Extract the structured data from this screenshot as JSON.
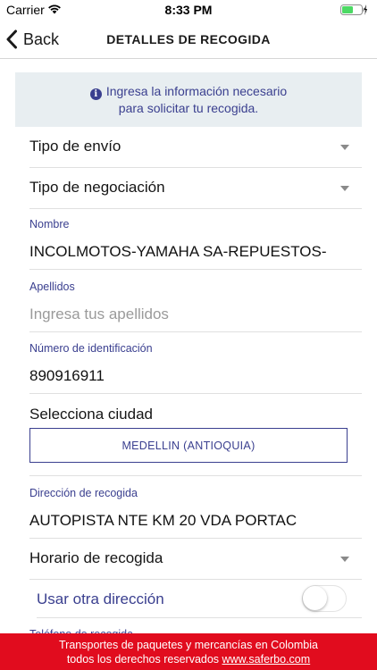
{
  "status_bar": {
    "carrier": "Carrier",
    "time": "8:33 PM"
  },
  "nav": {
    "back_label": "Back",
    "title": "DETALLES DE RECOGIDA"
  },
  "info": {
    "line1": "Ingresa la información necesario",
    "line2": "para solicitar tu recogida."
  },
  "form": {
    "shipment_type": "Tipo de envío",
    "negotiation_type": "Tipo de negociación",
    "name_label": "Nombre",
    "name_value": "INCOLMOTOS-YAMAHA SA-REPUESTOS-",
    "surname_label": "Apellidos",
    "surname_placeholder": "Ingresa tus apellidos",
    "id_label": "Número de identificación",
    "id_value": "890916911",
    "city_heading": "Selecciona ciudad",
    "city_value": "MEDELLIN (ANTIOQUIA)",
    "address_label": "Dirección de recogida",
    "address_value": "AUTOPISTA NTE KM 20 VDA PORTAC",
    "schedule": "Horario de recogida",
    "other_address_label": "Usar otra dirección",
    "other_address_on": false,
    "next_label": "Teléfono de recogida"
  },
  "footer": {
    "line1": "Transportes de paquetes y mercancías en Colombia",
    "line2_prefix": "todos los derechos reservados ",
    "link": "www.saferbo.com"
  },
  "colors": {
    "accent": "#3a3f8f",
    "footer_bg": "#e10c1e",
    "banner_bg": "#e8eef1"
  }
}
